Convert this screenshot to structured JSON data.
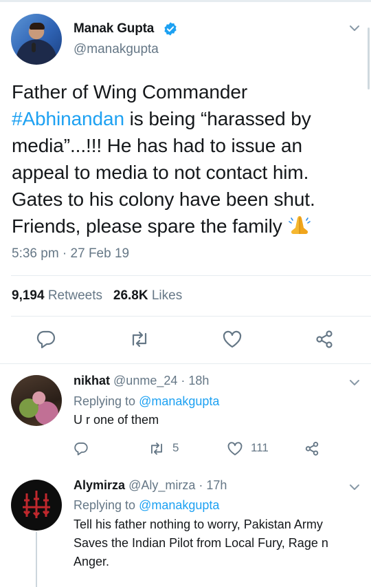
{
  "main_tweet": {
    "author_name": "Manak Gupta",
    "handle": "@manakgupta",
    "text_lines": [
      "Father of Wing Commander",
      " is being “harassed by",
      "media”...!!! He has had to issue an",
      "appeal to media to not contact him.",
      "Gates to his colony have been shut.",
      "Friends, please spare the family"
    ],
    "hashtag": "#Abhinandan",
    "emoji": "folded-hands-emoji",
    "timestamp": "5:36 pm · 27 Feb 19",
    "retweets_count": "9,194",
    "retweets_label": "Retweets",
    "likes_count": "26.8K",
    "likes_label": "Likes",
    "actions": [
      "reply-icon",
      "retweet-icon",
      "like-icon",
      "share-icon"
    ]
  },
  "replies": [
    {
      "name": "nikhat",
      "handle": "@unme_24",
      "time": "· 18h",
      "replying_prefix": "Replying to",
      "replying_to": "@manakgupta",
      "text": "U r one of them",
      "retweets": "5",
      "likes": "111"
    },
    {
      "name": "Alymirza",
      "handle": "@Aly_mirza",
      "time": "· 17h",
      "replying_prefix": "Replying to",
      "replying_to": "@manakgupta",
      "text_lines": [
        "Tell his father nothing to worry, Pakistan Army",
        "Saves the Indian Pilot from Local Fury, Rage n",
        "Anger."
      ]
    }
  ],
  "colors": {
    "accent": "#1da1f2",
    "secondary_text": "#657786",
    "primary_text": "#14171a",
    "avatar_emblem": "#c0282d"
  }
}
